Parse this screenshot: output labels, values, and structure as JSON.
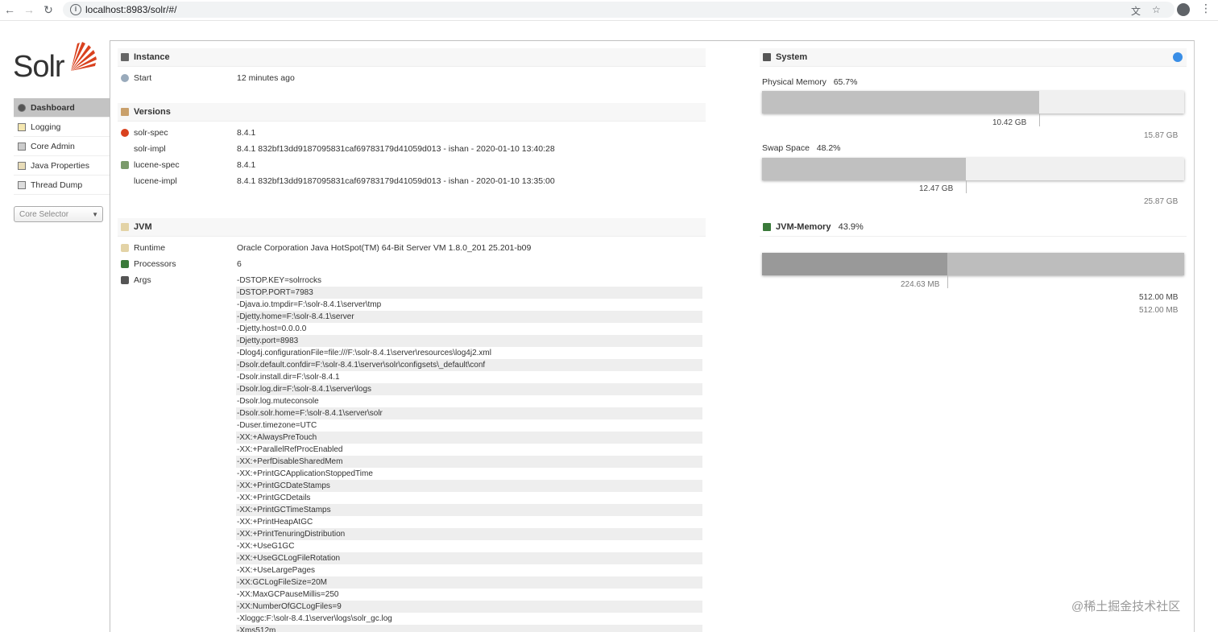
{
  "browser": {
    "url": "localhost:8983/solr/#/"
  },
  "sidebar": {
    "logo": "Solr",
    "items": [
      {
        "label": "Dashboard"
      },
      {
        "label": "Logging"
      },
      {
        "label": "Core Admin"
      },
      {
        "label": "Java Properties"
      },
      {
        "label": "Thread Dump"
      }
    ],
    "core_selector": "Core Selector"
  },
  "instance": {
    "title": "Instance",
    "start_label": "Start",
    "start_value": "12 minutes ago"
  },
  "versions": {
    "title": "Versions",
    "rows": [
      {
        "key": "solr-spec",
        "value": "8.4.1"
      },
      {
        "key": "solr-impl",
        "value": "8.4.1 832bf13dd9187095831caf69783179d41059d013 - ishan - 2020-01-10 13:40:28"
      },
      {
        "key": "lucene-spec",
        "value": "8.4.1"
      },
      {
        "key": "lucene-impl",
        "value": "8.4.1 832bf13dd9187095831caf69783179d41059d013 - ishan - 2020-01-10 13:35:00"
      }
    ]
  },
  "jvm": {
    "title": "JVM",
    "runtime_label": "Runtime",
    "runtime_value": "Oracle Corporation Java HotSpot(TM) 64-Bit Server VM 1.8.0_201 25.201-b09",
    "processors_label": "Processors",
    "processors_value": "6",
    "args_label": "Args",
    "args": [
      "-DSTOP.KEY=solrrocks",
      "-DSTOP.PORT=7983",
      "-Djava.io.tmpdir=F:\\solr-8.4.1\\server\\tmp",
      "-Djetty.home=F:\\solr-8.4.1\\server",
      "-Djetty.host=0.0.0.0",
      "-Djetty.port=8983",
      "-Dlog4j.configurationFile=file:///F:\\solr-8.4.1\\server\\resources\\log4j2.xml",
      "-Dsolr.default.confdir=F:\\solr-8.4.1\\server\\solr\\configsets\\_default\\conf",
      "-Dsolr.install.dir=F:\\solr-8.4.1",
      "-Dsolr.log.dir=F:\\solr-8.4.1\\server\\logs",
      "-Dsolr.log.muteconsole",
      "-Dsolr.solr.home=F:\\solr-8.4.1\\server\\solr",
      "-Duser.timezone=UTC",
      "-XX:+AlwaysPreTouch",
      "-XX:+ParallelRefProcEnabled",
      "-XX:+PerfDisableSharedMem",
      "-XX:+PrintGCApplicationStoppedTime",
      "-XX:+PrintGCDateStamps",
      "-XX:+PrintGCDetails",
      "-XX:+PrintGCTimeStamps",
      "-XX:+PrintHeapAtGC",
      "-XX:+PrintTenuringDistribution",
      "-XX:+UseG1GC",
      "-XX:+UseGCLogFileRotation",
      "-XX:+UseLargePages",
      "-XX:GCLogFileSize=20M",
      "-XX:MaxGCPauseMillis=250",
      "-XX:NumberOfGCLogFiles=9",
      "-Xloggc:F:\\solr-8.4.1\\server\\logs\\solr_gc.log",
      "-Xms512m"
    ]
  },
  "system": {
    "title": "System",
    "physical": {
      "label": "Physical Memory",
      "percent": "65.7%",
      "used": "10.42 GB",
      "total": "15.87 GB",
      "fraction": 0.657
    },
    "swap": {
      "label": "Swap Space",
      "percent": "48.2%",
      "used": "12.47 GB",
      "total": "25.87 GB",
      "fraction": 0.482
    },
    "jvm_memory": {
      "label": "JVM-Memory",
      "percent": "43.9%",
      "used": "224.63 MB",
      "committed": "512.00 MB",
      "max": "512.00 MB",
      "fraction_used": 0.439,
      "fraction_committed": 1.0
    }
  },
  "watermark": "@稀土掘金技术社区"
}
